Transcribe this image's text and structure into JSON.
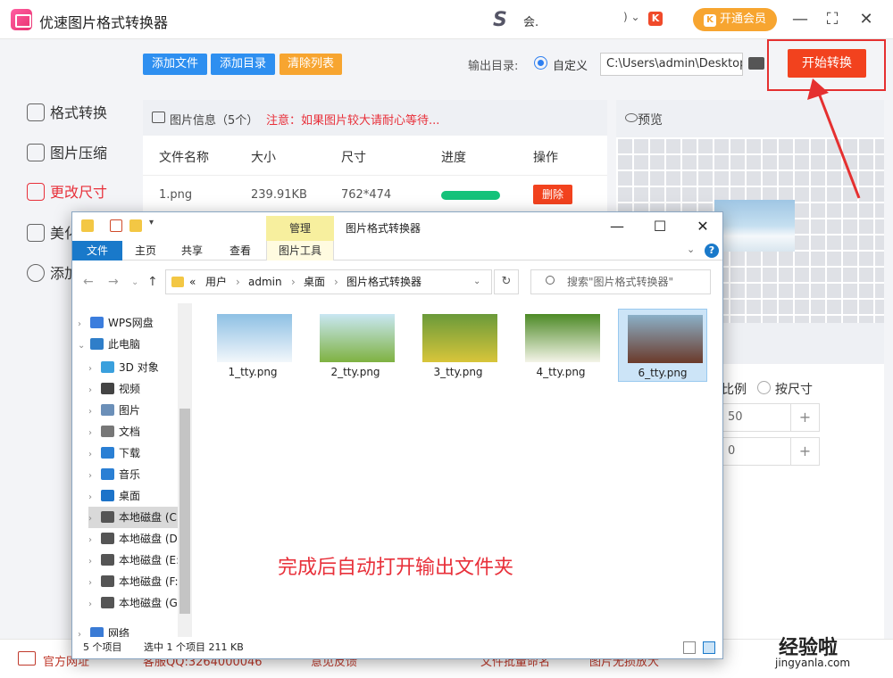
{
  "app": {
    "title": "优速图片格式转换器",
    "user_name": "会.",
    "user_menu_chev": ") ⌄",
    "vip_icon": "K",
    "vip_button": "开通会员",
    "controls": {
      "minimize": "—",
      "maximize": "⛶",
      "close": "✕"
    }
  },
  "nav": {
    "items": [
      {
        "label": "格式转换",
        "icon": "format-convert-icon"
      },
      {
        "label": "图片压缩",
        "icon": "compress-icon"
      },
      {
        "label": "更改尺寸",
        "icon": "resize-icon",
        "active": true
      },
      {
        "label": "美化",
        "icon": "beautify-icon"
      },
      {
        "label": "添加",
        "icon": "watermark-icon"
      }
    ]
  },
  "toolbar": {
    "add_file": "添加文件",
    "add_dir": "添加目录",
    "clear_list": "清除列表",
    "output_label": "输出目录:",
    "output_option": "自定义",
    "output_path": "C:\\Users\\admin\\Desktop",
    "start": "开始转换"
  },
  "filelist": {
    "title": "图片信息（5个）",
    "note": "注意：如果图片较大请耐心等待...",
    "columns": [
      "文件名称",
      "大小",
      "尺寸",
      "进度",
      "操作"
    ],
    "rows": [
      {
        "name": "1.png",
        "size": "239.91KB",
        "dims": "762*474",
        "progress": 1.0,
        "action": "删除"
      }
    ]
  },
  "preview": {
    "title": "预览",
    "ratio_label": "比例",
    "size_option": "按尺寸",
    "value1": "50",
    "value2": "0"
  },
  "bottombar": {
    "items": [
      "官方网址",
      "客服QQ:3264000046",
      "意见反馈",
      "文件批量命名",
      "图片无损放大"
    ]
  },
  "explorer": {
    "manage_tab": "管理",
    "title": "图片格式转换器",
    "tabs": [
      "文件",
      "主页",
      "共享",
      "查看",
      "图片工具"
    ],
    "breadcrumb": [
      "«",
      "用户",
      "admin",
      "桌面",
      "图片格式转换器"
    ],
    "search_placeholder": "搜索\"图片格式转换器\"",
    "tree": [
      {
        "label": "WPS网盘",
        "color": "#3b7ddd",
        "indent": 0
      },
      {
        "label": "此电脑",
        "color": "#2f7ec9",
        "indent": 0,
        "expanded": true
      },
      {
        "label": "3D 对象",
        "color": "#3aa0dd",
        "indent": 1
      },
      {
        "label": "视频",
        "color": "#444444",
        "indent": 1
      },
      {
        "label": "图片",
        "color": "#6b8fb8",
        "indent": 1
      },
      {
        "label": "文档",
        "color": "#777777",
        "indent": 1
      },
      {
        "label": "下载",
        "color": "#2a7fd4",
        "indent": 1
      },
      {
        "label": "音乐",
        "color": "#2a7fd4",
        "indent": 1
      },
      {
        "label": "桌面",
        "color": "#1c73c9",
        "indent": 1
      },
      {
        "label": "本地磁盘 (C:)",
        "color": "#555555",
        "indent": 1,
        "selected": true
      },
      {
        "label": "本地磁盘 (D:)",
        "color": "#555555",
        "indent": 1
      },
      {
        "label": "本地磁盘 (E:)",
        "color": "#555555",
        "indent": 1
      },
      {
        "label": "本地磁盘 (F:)",
        "color": "#555555",
        "indent": 1
      },
      {
        "label": "本地磁盘 (G:)",
        "color": "#555555",
        "indent": 1
      },
      {
        "label": "网络",
        "color": "#3a7bd5",
        "indent": 0
      }
    ],
    "files": [
      {
        "name": "1_tty.png",
        "palette": [
          "#8ec0e4",
          "#f2f7fb"
        ]
      },
      {
        "name": "2_tty.png",
        "palette": [
          "#c9e7f3",
          "#7fb241"
        ]
      },
      {
        "name": "3_tty.png",
        "palette": [
          "#6a9a3a",
          "#d8c53a"
        ]
      },
      {
        "name": "4_tty.png",
        "palette": [
          "#4d8a26",
          "#f4f4e8"
        ]
      },
      {
        "name": "6_tty.png",
        "palette": [
          "#8bb0c8",
          "#6b3a2a"
        ],
        "selected": true
      }
    ],
    "annotation": "完成后自动打开输出文件夹",
    "status_count": "5 个项目",
    "status_selected": "选中 1 个项目  211 KB"
  },
  "watermark": {
    "main": "经验啦",
    "sub": "jingyanla.com"
  },
  "colors": {
    "accent_red": "#f2421e",
    "blue_btn": "#2e8ff0",
    "orange_btn": "#f7a530",
    "progress": "#15c27a"
  }
}
